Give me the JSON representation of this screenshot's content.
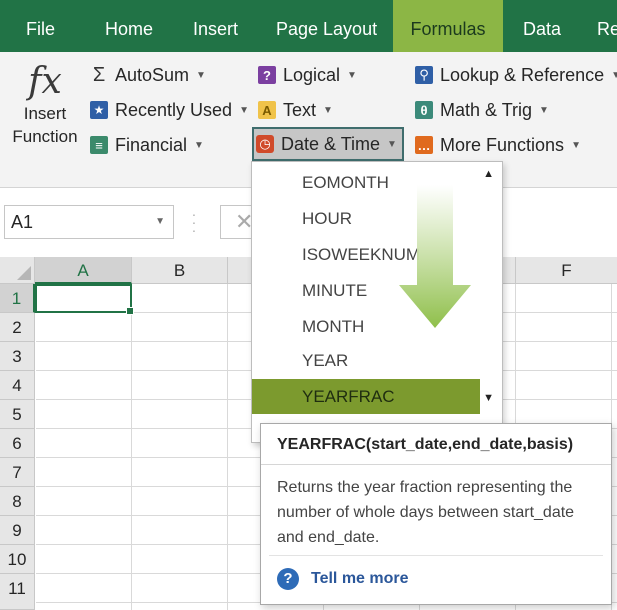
{
  "tabs": [
    {
      "label": "File",
      "active": false
    },
    {
      "label": "Home",
      "active": false
    },
    {
      "label": "Insert",
      "active": false
    },
    {
      "label": "Page Layout",
      "active": false
    },
    {
      "label": "Formulas",
      "active": true
    },
    {
      "label": "Data",
      "active": false
    },
    {
      "label": "Re",
      "active": false
    }
  ],
  "ribbon": {
    "insert_function": {
      "glyph": "fx",
      "line1": "Insert",
      "line2": "Function"
    },
    "autosum": "AutoSum",
    "recently_used": "Recently Used",
    "financial": "Financial",
    "logical": "Logical",
    "text": "Text",
    "date_time": "Date & Time",
    "lookup_reference": "Lookup & Reference",
    "math_trig": "Math & Trig",
    "more_functions": "More Functions"
  },
  "formula_bar": {
    "name_box": "A1",
    "cancel_glyph": "✕"
  },
  "grid": {
    "columns": [
      "A",
      "B",
      "F"
    ],
    "rows": [
      "1",
      "2",
      "3",
      "4",
      "5",
      "6",
      "7",
      "8",
      "9",
      "10",
      "11"
    ],
    "active_cell": "A1"
  },
  "dropdown": {
    "items": [
      {
        "label": "EOMONTH",
        "highlighted": false
      },
      {
        "label": "HOUR",
        "highlighted": false
      },
      {
        "label": "ISOWEEKNUM",
        "highlighted": false
      },
      {
        "label": "MINUTE",
        "highlighted": false
      },
      {
        "label": "MONTH",
        "highlighted": false
      },
      {
        "label": "YEAR",
        "highlighted": false
      },
      {
        "label": "YEARFRAC",
        "highlighted": true
      }
    ]
  },
  "tooltip": {
    "syntax": "YEARFRAC(start_date,end_date,basis)",
    "description": "Returns the year fraction representing the number of whole days between start_date and end_date.",
    "help_icon": "?",
    "help_link": "Tell me more"
  },
  "colors": {
    "ribbon_green": "#217346",
    "active_tab": "#8cb645",
    "highlight_item": "#7c9a2e",
    "arrow_green": "#8fbf4a",
    "link_blue": "#2b579a"
  },
  "icons": {
    "autosum": "sigma-icon",
    "recently_used": "star-icon",
    "financial": "financial-book-icon",
    "logical": "question-book-icon",
    "text": "text-a-icon",
    "date_time": "clock-icon",
    "lookup_reference": "magnifier-book-icon",
    "math_trig": "theta-book-icon",
    "more_functions": "ellipsis-book-icon",
    "help": "help-question-icon"
  }
}
